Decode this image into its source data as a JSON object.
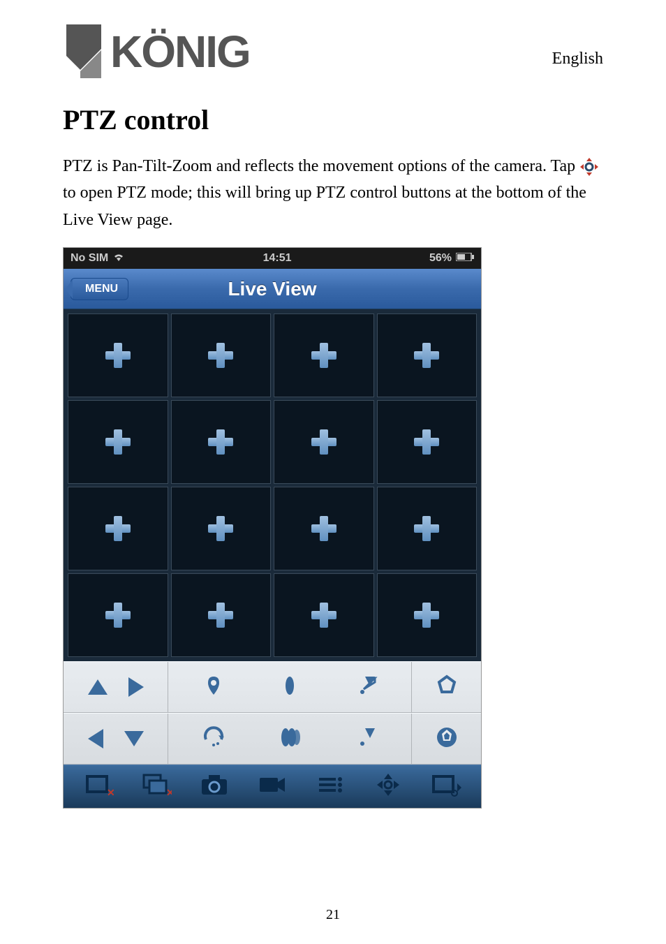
{
  "header": {
    "logo_text": "KÖNIG",
    "language": "English"
  },
  "heading": "PTZ control",
  "body": {
    "para1a": "PTZ is Pan-Tilt-Zoom and reflects the movement options of the camera. Tap ",
    "para1b": " to open PTZ mode; this will bring up PTZ control buttons at the bottom of the Live View page."
  },
  "screenshot": {
    "status_bar": {
      "carrier": "No SIM",
      "time": "14:51",
      "battery": "56%"
    },
    "nav": {
      "menu_label": "MENU",
      "title": "Live View"
    },
    "grid": {
      "rows": 4,
      "cols": 4
    },
    "ptz_controls": {
      "row1": {
        "arrows": [
          "up",
          "right"
        ],
        "icons": [
          "preset-point-icon",
          "focus-near-icon",
          "zoom-in-icon"
        ],
        "right": "iris-open-icon"
      },
      "row2": {
        "arrows": [
          "left",
          "down"
        ],
        "icons": [
          "auto-scan-icon",
          "focus-far-icon",
          "zoom-out-icon"
        ],
        "right": "iris-close-icon"
      }
    },
    "bottom_bar": {
      "icons": [
        "close-window-icon",
        "close-all-icon",
        "snapshot-icon",
        "record-icon",
        "quality-icon",
        "ptz-mode-icon",
        "fullscreen-icon"
      ]
    }
  },
  "page_number": "21"
}
